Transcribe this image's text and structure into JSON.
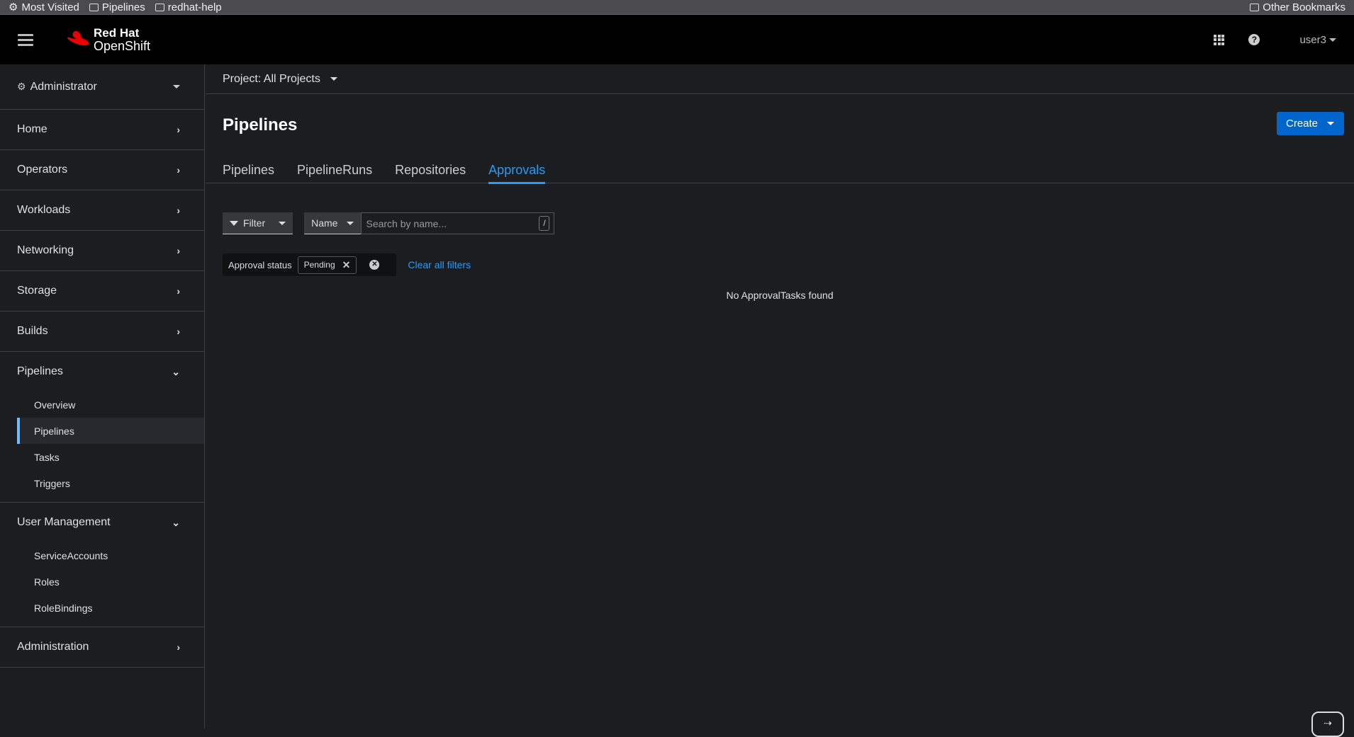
{
  "bookmarks": {
    "items": [
      "Most Visited",
      "Pipelines",
      "redhat-help"
    ],
    "other": "Other Bookmarks"
  },
  "masthead": {
    "brand_line1": "Red Hat",
    "brand_line2": "OpenShift",
    "user": "user3"
  },
  "sidebar": {
    "perspective": "Administrator",
    "sections": [
      {
        "label": "Home",
        "expanded": false
      },
      {
        "label": "Operators",
        "expanded": false
      },
      {
        "label": "Workloads",
        "expanded": false
      },
      {
        "label": "Networking",
        "expanded": false
      },
      {
        "label": "Storage",
        "expanded": false
      },
      {
        "label": "Builds",
        "expanded": false
      },
      {
        "label": "Pipelines",
        "expanded": true,
        "items": [
          "Overview",
          "Pipelines",
          "Tasks",
          "Triggers"
        ],
        "active": "Pipelines"
      },
      {
        "label": "User Management",
        "expanded": true,
        "items": [
          "ServiceAccounts",
          "Roles",
          "RoleBindings"
        ]
      },
      {
        "label": "Administration",
        "expanded": false
      }
    ]
  },
  "main": {
    "project": "Project: All Projects",
    "title": "Pipelines",
    "create_label": "Create",
    "tabs": [
      "Pipelines",
      "PipelineRuns",
      "Repositories",
      "Approvals"
    ],
    "active_tab": "Approvals",
    "filter_label": "Filter",
    "name_label": "Name",
    "search_placeholder": "Search by name...",
    "search_shortcut": "/",
    "chip_group_label": "Approval status",
    "chip": "Pending",
    "clear_all": "Clear all filters",
    "empty_message": "No ApprovalTasks found"
  },
  "colors": {
    "accent": "#2b9af3",
    "primary_button": "#0066cc",
    "brand_red": "#ee0000"
  }
}
